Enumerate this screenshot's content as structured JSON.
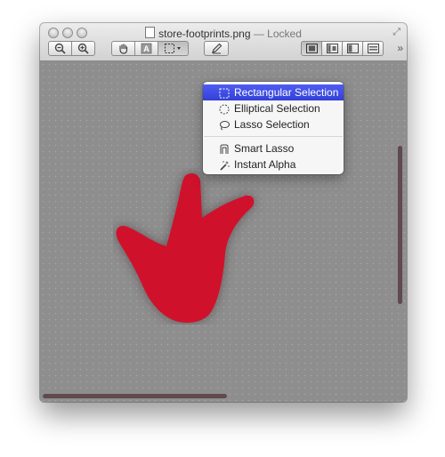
{
  "window": {
    "title": "store-footprints.png",
    "status": "— Locked"
  },
  "toolbar": {
    "buttons": [
      {
        "name": "zoom-out",
        "icon": "zoom-out-icon"
      },
      {
        "name": "zoom-in",
        "icon": "zoom-in-icon"
      },
      {
        "name": "hand-tool",
        "icon": "hand-icon"
      },
      {
        "name": "text-tool",
        "icon": "text-tool-icon",
        "glyph": "A"
      },
      {
        "name": "selection-tool",
        "icon": "rect-selection-icon",
        "state": "active"
      },
      {
        "name": "annotate",
        "icon": "pen-icon"
      },
      {
        "name": "view-single",
        "icon": "single-page-icon",
        "state": "active"
      },
      {
        "name": "view-sidebar",
        "icon": "sidebar-icon"
      },
      {
        "name": "view-two-page",
        "icon": "two-page-icon"
      },
      {
        "name": "view-contact",
        "icon": "contact-sheet-icon"
      }
    ],
    "overflow_glyph": "»"
  },
  "selection_menu": {
    "items": [
      {
        "label": "Rectangular Selection",
        "icon": "rect-selection-icon",
        "selected": true
      },
      {
        "label": "Elliptical Selection",
        "icon": "elliptical-selection-icon"
      },
      {
        "label": "Lasso Selection",
        "icon": "lasso-icon"
      },
      {
        "label": "Smart Lasso",
        "icon": "smart-lasso-icon"
      },
      {
        "label": "Instant Alpha",
        "icon": "magic-wand-icon"
      }
    ]
  },
  "colors": {
    "footprint": "#d0112b",
    "menu_highlight": "#3e4ae3",
    "scrollbar": "#5f4a4e"
  }
}
